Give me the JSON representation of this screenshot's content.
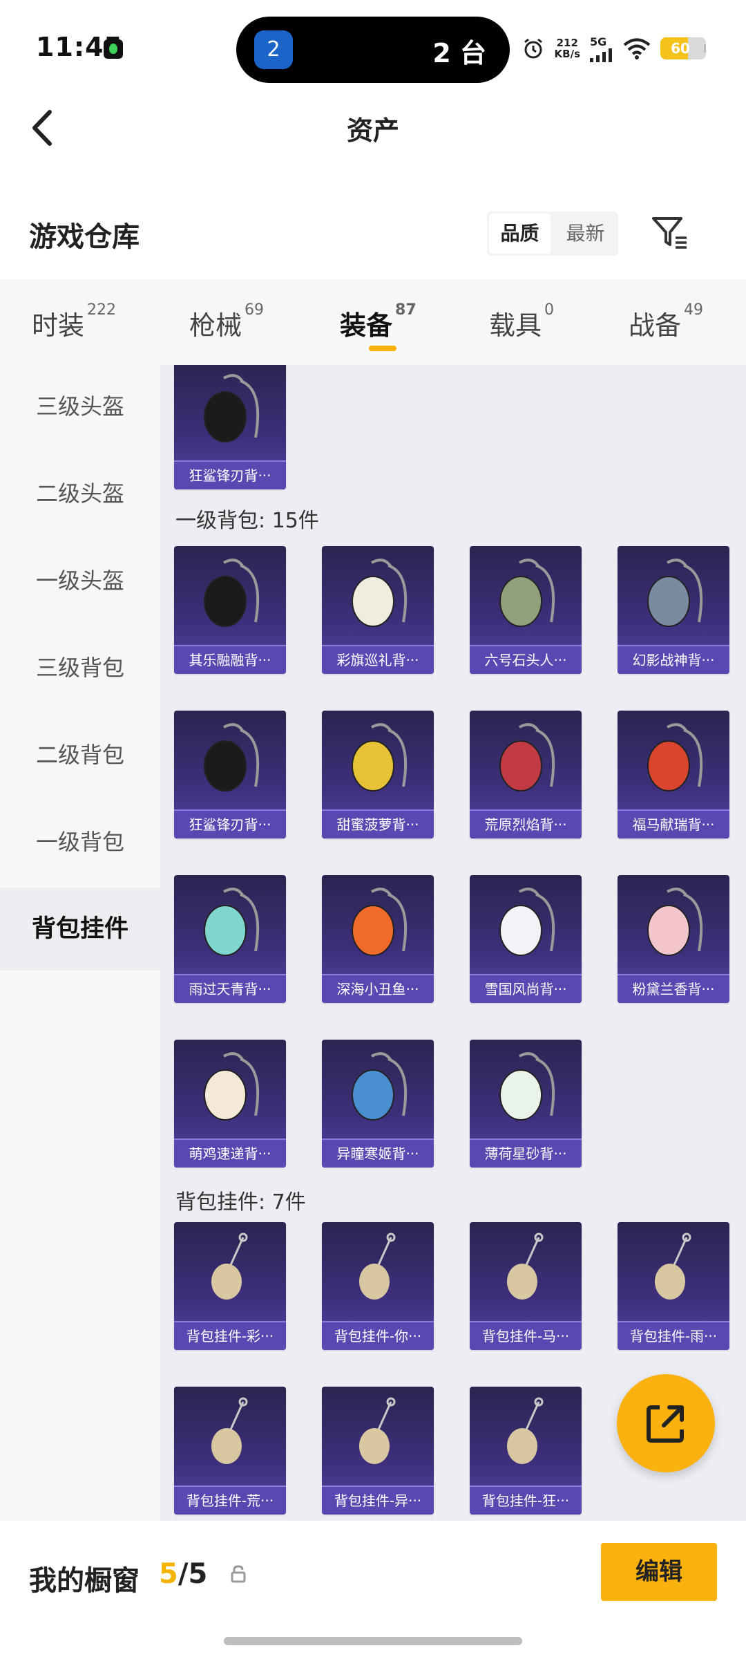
{
  "status_bar": {
    "time": "11:45",
    "island_icon_text": "2",
    "island_text": "2 台",
    "speed_value": "212",
    "speed_unit": "KB/s",
    "network": "5G",
    "battery": "60",
    "battery_level": 0.6,
    "icons": [
      "alarm-icon",
      "signal-icon",
      "wifi-icon",
      "battery-icon"
    ]
  },
  "header": {
    "title": "资产",
    "warehouse_title": "游戏仓库",
    "sort_options": [
      "品质",
      "最新"
    ],
    "active_sort": "品质"
  },
  "tabs": [
    {
      "label": "时装",
      "count": "222"
    },
    {
      "label": "枪械",
      "count": "69"
    },
    {
      "label": "装备",
      "count": "87",
      "active": true
    },
    {
      "label": "载具",
      "count": "0"
    },
    {
      "label": "战备",
      "count": "49"
    }
  ],
  "sidebar": {
    "items": [
      "三级头盔",
      "二级头盔",
      "一级头盔",
      "三级背包",
      "二级背包",
      "一级背包",
      "背包挂件"
    ],
    "active": "背包挂件"
  },
  "sections": [
    {
      "label": "",
      "items": [
        "狂鲨锋刃背···"
      ]
    },
    {
      "label": "一级背包: 15件",
      "items": [
        "其乐融融背···",
        "彩旗巡礼背···",
        "六号石头人···",
        "幻影战神背···",
        "狂鲨锋刃背···",
        "甜蜜菠萝背···",
        "荒原烈焰背···",
        "福马献瑞背···",
        "雨过天青背···",
        "深海小丑鱼···",
        "雪国风尚背···",
        "粉黛兰香背···",
        "萌鸡速递背···",
        "异瞳寒姬背···",
        "薄荷星砂背···"
      ]
    },
    {
      "label": "背包挂件: 7件",
      "items": [
        "背包挂件-彩···",
        "背包挂件-你···",
        "背包挂件-马···",
        "背包挂件-雨···",
        "背包挂件-荒···",
        "背包挂件-异···",
        "背包挂件-狂···"
      ]
    }
  ],
  "bottom_bar": {
    "title": "我的橱窗",
    "count_current": "5",
    "count_total": "/5",
    "edit_label": "编辑"
  },
  "colors": {
    "accent": "#fbb20e",
    "card_bg": "#3e2f7c",
    "card_label_bg": "#5a47b2"
  }
}
